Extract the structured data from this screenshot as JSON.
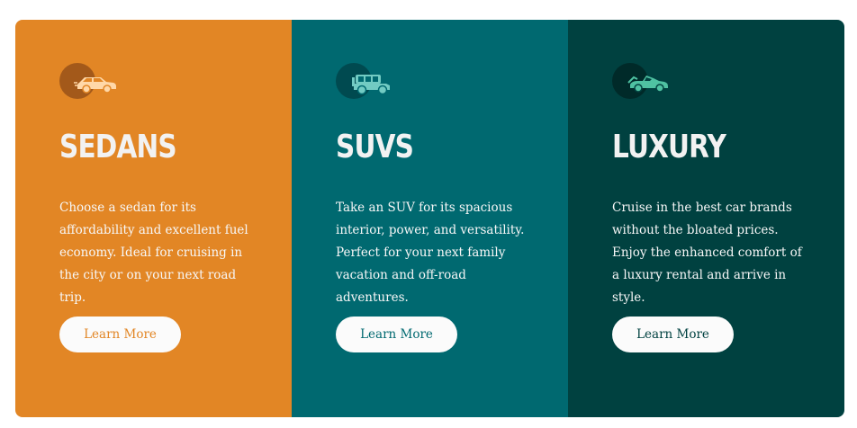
{
  "cards": [
    {
      "title": "SEDANS",
      "description": "Choose a sedan for its affordability and excellent fuel economy. Ideal for cruising in the city or on your next road trip.",
      "button_label": "Learn More",
      "icon": "sedan-car-icon",
      "color": "#e28625"
    },
    {
      "title": "SUVS",
      "description": "Take an SUV for its spacious interior, power, and versatility. Perfect for your next family vacation and off-road adventures.",
      "button_label": "Learn More",
      "icon": "suv-car-icon",
      "color": "#006970"
    },
    {
      "title": "LUXURY",
      "description": "Cruise in the best car brands without the bloated prices. Enjoy the enhanced comfort of a luxury rental and arrive in style.",
      "button_label": "Learn More",
      "icon": "luxury-car-icon",
      "color": "#004140"
    }
  ],
  "colors": {
    "sedans_bg": "#e28625",
    "suvs_bg": "#006970",
    "luxury_bg": "#004140",
    "text": "#f2f2f2",
    "button_bg": "#fbfbfb"
  }
}
